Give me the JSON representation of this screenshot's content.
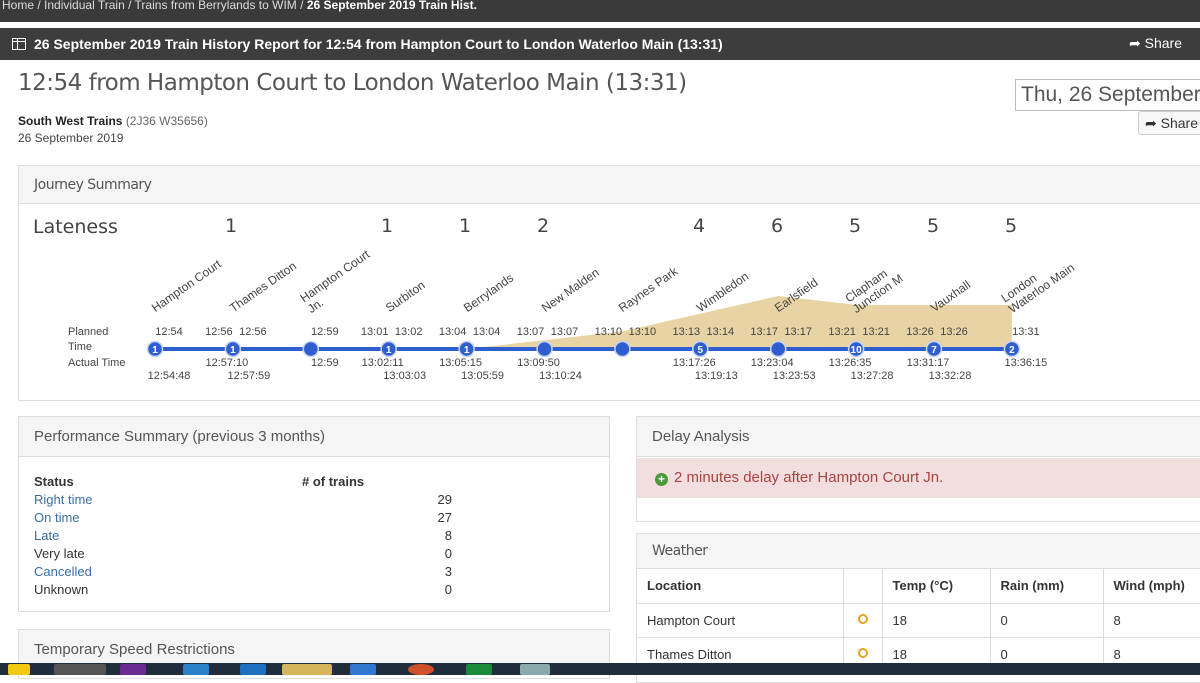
{
  "breadcrumb": {
    "items": [
      "Home",
      "Individual Train",
      "Trains from Berrylands to WIM"
    ],
    "current": "26 September 2019 Train Hist."
  },
  "header": {
    "title": "26 September 2019 Train History Report for 12:54 from Hampton Court to London Waterloo Main (13:31)",
    "share_label": "Share"
  },
  "route_title": "12:54 from Hampton Court to London Waterloo Main (13:31)",
  "date_picker_value": "Thu, 26 September",
  "share_button_label": "Share",
  "operator": {
    "name": "South West Trains",
    "code": "(2J36 W35656)"
  },
  "run_date": "26 September 2019",
  "journey": {
    "panel_title": "Journey Summary",
    "lateness_label": "Lateness",
    "planned_label_1": "Planned",
    "planned_label_2": "Time",
    "actual_label": "Actual Time",
    "lateness": [
      "1",
      "",
      "1",
      "1",
      "2",
      "",
      "4",
      "6",
      "5",
      "5",
      "5"
    ],
    "stations": [
      {
        "name": "Hampton Court",
        "lines": [
          "Hampton Court"
        ],
        "planned": [
          "12:54"
        ],
        "actual": [
          "12:54:48"
        ],
        "marker": "1"
      },
      {
        "name": "Thames Ditton",
        "lines": [
          "Thames Ditton"
        ],
        "planned": [
          "12:56",
          "12:56"
        ],
        "actual": [
          "12:57:10",
          "12:57:59"
        ],
        "marker": "1"
      },
      {
        "name": "Hampton Court Jn.",
        "lines": [
          "Hampton Court",
          "Jn."
        ],
        "planned": [
          "12:59"
        ],
        "actual": [
          "12:59"
        ],
        "marker": ""
      },
      {
        "name": "Surbiton",
        "lines": [
          "Surbiton"
        ],
        "planned": [
          "13:01",
          "13:02"
        ],
        "actual": [
          "13:02:11",
          "13:03:03"
        ],
        "marker": "1"
      },
      {
        "name": "Berrylands",
        "lines": [
          "Berrylands"
        ],
        "planned": [
          "13:04",
          "13:04"
        ],
        "actual": [
          "13:05:15",
          "13:05:59"
        ],
        "marker": "1"
      },
      {
        "name": "New Malden",
        "lines": [
          "New Malden"
        ],
        "planned": [
          "13:07",
          "13:07"
        ],
        "actual": [
          "13:09:50",
          "13:10:24"
        ],
        "marker": ""
      },
      {
        "name": "Raynes Park",
        "lines": [
          "Raynes Park"
        ],
        "planned": [
          "13:10",
          "13:10"
        ],
        "actual": [],
        "marker": ""
      },
      {
        "name": "Wimbledon",
        "lines": [
          "Wimbledon"
        ],
        "planned": [
          "13:13",
          "13:14"
        ],
        "actual": [
          "13:17:26",
          "13:19:13"
        ],
        "marker": "5"
      },
      {
        "name": "Earlsfield",
        "lines": [
          "Earlsfield"
        ],
        "planned": [
          "13:17",
          "13:17"
        ],
        "actual": [
          "13:23:04",
          "13:23:53"
        ],
        "marker": ""
      },
      {
        "name": "Clapham Junction M",
        "lines": [
          "Clapham",
          "Junction M"
        ],
        "planned": [
          "13:21",
          "13:21"
        ],
        "actual": [
          "13:26:35",
          "13:27:28"
        ],
        "marker": "10"
      },
      {
        "name": "Vauxhall",
        "lines": [
          "Vauxhall"
        ],
        "planned": [
          "13:26",
          "13:26"
        ],
        "actual": [
          "13:31:17",
          "13:32:28"
        ],
        "marker": "7"
      },
      {
        "name": "London Waterloo Main",
        "lines": [
          "London",
          "Waterloo Main"
        ],
        "planned": [
          "13:31"
        ],
        "actual": [
          "13:36:15"
        ],
        "marker": "2"
      }
    ],
    "delay_profile_minutes": [
      0,
      0,
      0,
      0,
      0,
      1,
      2,
      4,
      6,
      5,
      5,
      5
    ]
  },
  "performance": {
    "panel_title": "Performance Summary (previous 3 months)",
    "col_status": "Status",
    "col_count": "# of trains",
    "rows": [
      {
        "status": "Right time",
        "count": "29",
        "link": true
      },
      {
        "status": "On time",
        "count": "27",
        "link": true
      },
      {
        "status": "Late",
        "count": "8",
        "link": true
      },
      {
        "status": "Very late",
        "count": "0",
        "link": false
      },
      {
        "status": "Cancelled",
        "count": "3",
        "link": true
      },
      {
        "status": "Unknown",
        "count": "0",
        "link": false
      }
    ]
  },
  "tsr": {
    "panel_title": "Temporary Speed Restrictions"
  },
  "delay_analysis": {
    "panel_title": "Delay Analysis",
    "message": "2 minutes delay after Hampton Court Jn.",
    "icon": "plus-circle-icon"
  },
  "weather": {
    "panel_title": "Weather",
    "headers": [
      "Location",
      "",
      "Temp (°C)",
      "Rain (mm)",
      "Wind (mph)"
    ],
    "rows": [
      {
        "location": "Hampton Court",
        "icon": "sun-icon",
        "temp": "18",
        "rain": "0",
        "wind": "8"
      },
      {
        "location": "Thames Ditton",
        "icon": "sun-icon",
        "temp": "18",
        "rain": "0",
        "wind": "8"
      }
    ]
  },
  "colors": {
    "line": "#2f5fcf",
    "delay_fill": "#e8d3a4",
    "alert_bg": "#f2dede",
    "alert_text": "#a94442",
    "link": "#3a6ea5"
  }
}
